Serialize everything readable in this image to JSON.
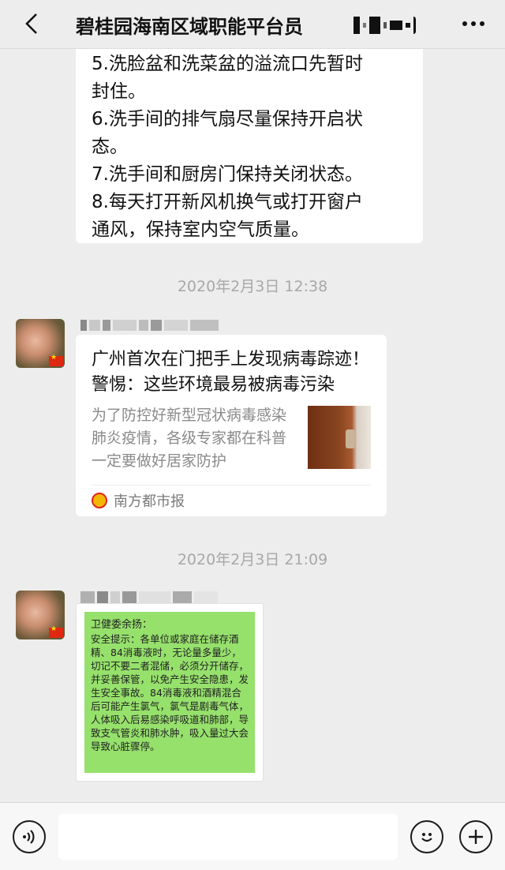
{
  "header": {
    "title": "碧桂园海南区域职能平台员"
  },
  "messages": {
    "text_bubble_lines": [
      "5.洗脸盆和洗菜盆的溢流口先暂时",
      "封住。",
      "6.洗手间的排气扇尽量保持开启状",
      "态。",
      "7.洗手间和厨房门保持关闭状态。",
      "8.每天打开新风机换气或打开窗户",
      "通风，保持室内空气质量。"
    ],
    "timestamp_1": "2020年2月3日 12:38",
    "link_card": {
      "title": "广州首次在门把手上发现病毒踪迹！ 警惕：这些环境最易被病毒污染",
      "description": "为了防控好新型冠状病毒感染肺炎疫情，各级专家都在科普一定要做好居家防护",
      "source": "南方都市报"
    },
    "timestamp_2": "2020年2月3日 21:09",
    "image_text": {
      "heading": "卫健委余扬：",
      "body": "安全提示：各单位或家庭在储存酒精、84消毒液时，无论量多量少，切记不要二者混储，必须分开储存，并妥善保管，以免产生安全隐患，发生安全事故。84消毒液和酒精混合后可能产生氯气，氯气是剧毒气体，人体吸入后易感染呼吸道和肺部，导致支气管炎和肺水肿，吸入量过大会导致心脏骤停。"
    }
  },
  "colors": {
    "background": "#ededed",
    "bubble": "#ffffff",
    "image_green": "#96e16c",
    "timestamp": "#a8a8a8"
  },
  "icons": [
    "back-arrow-icon",
    "more-icon",
    "voice-icon",
    "emoji-icon",
    "plus-icon",
    "flag-icon",
    "source-logo-icon"
  ]
}
